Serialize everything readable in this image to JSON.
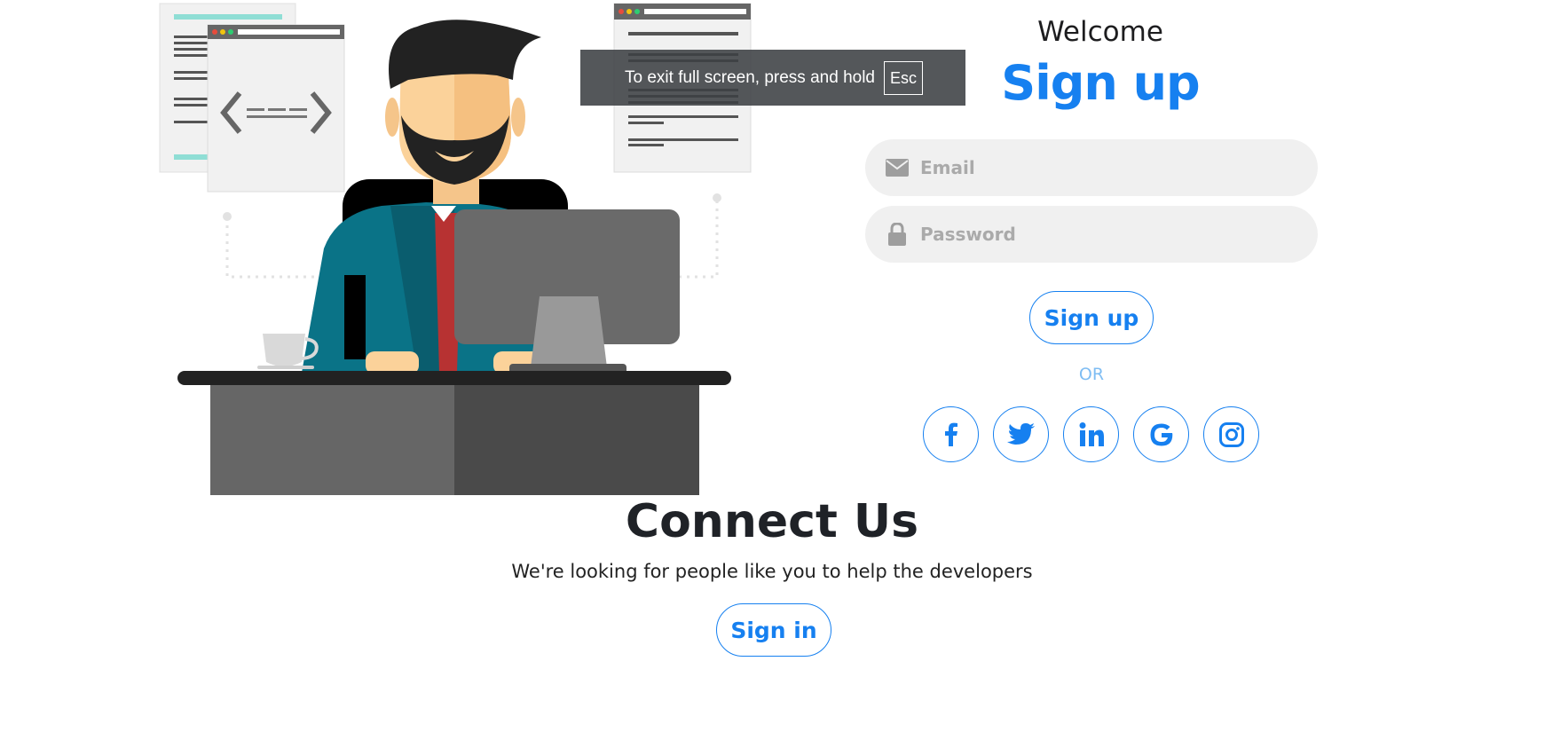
{
  "form": {
    "welcome": "Welcome",
    "title": "Sign up",
    "email_placeholder": "Email",
    "password_placeholder": "Password",
    "submit_label": "Sign up",
    "divider": "OR",
    "email_icon": "envelope-icon",
    "password_icon": "lock-icon"
  },
  "socials": [
    "facebook-icon",
    "twitter-icon",
    "linkedin-icon",
    "google-icon",
    "instagram-icon"
  ],
  "connect": {
    "title": "Connect Us",
    "tagline": "We're looking for people like you to help the developers",
    "signin_label": "Sign in"
  },
  "toast": {
    "message": "To exit full screen, press and hold",
    "key": "Esc"
  },
  "colors": {
    "accent": "#1680f0",
    "field_bg": "#f0f0f0",
    "divider": "#7fbdf3"
  }
}
